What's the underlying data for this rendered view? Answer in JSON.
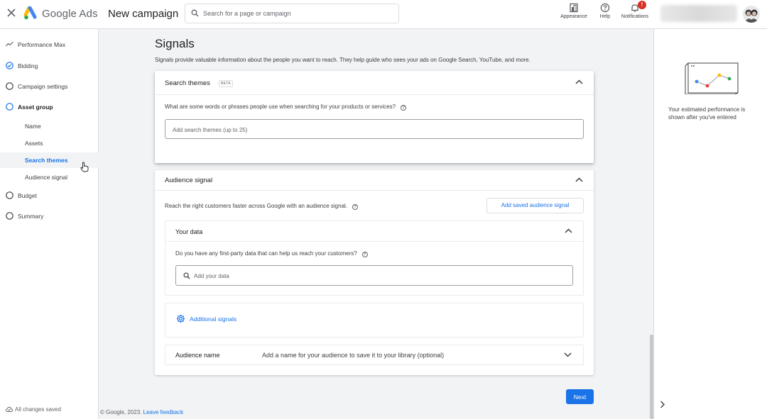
{
  "header": {
    "brand": "Google Ads",
    "campaign_title": "New campaign",
    "search_placeholder": "Search for a page or campaign",
    "appearance_label": "Appearance",
    "help_label": "Help",
    "notifications_label": "Notifications",
    "notifications_badge": "!"
  },
  "sidebar": {
    "items": [
      {
        "label": "Performance Max",
        "icon": "trend-icon"
      },
      {
        "label": "Bidding",
        "icon": "check-circle-icon"
      },
      {
        "label": "Campaign settings",
        "icon": "circle-icon"
      },
      {
        "label": "Asset group",
        "icon": "circle-icon"
      },
      {
        "label": "Budget",
        "icon": "circle-icon"
      },
      {
        "label": "Summary",
        "icon": "circle-icon"
      }
    ],
    "sub_items": [
      {
        "label": "Name"
      },
      {
        "label": "Assets"
      },
      {
        "label": "Search themes",
        "active": true
      },
      {
        "label": "Audience signal"
      }
    ],
    "saved_status": "All changes saved"
  },
  "main": {
    "title": "Signals",
    "description": "Signals provide valuable information about the people you want to reach. They help guide who sees your ads on Google Search, YouTube, and more.",
    "search_themes": {
      "title": "Search themes",
      "badge": "BETA",
      "question": "What are some words or phrases people use when searching for your products or services?",
      "input_placeholder": "Add search themes (up to 25)"
    },
    "audience_signal": {
      "title": "Audience signal",
      "description": "Reach the right customers faster across Google with an audience signal.",
      "add_saved_button": "Add saved audience signal",
      "your_data": {
        "title": "Your data",
        "question": "Do you have any first-party data that can help us reach your customers?",
        "input_placeholder": "Add your data"
      },
      "additional_signals": "Additional signals",
      "audience_name": {
        "label": "Audience name",
        "placeholder": "Add a name for your audience to save it to your library (optional)"
      }
    },
    "next_button": "Next"
  },
  "footer": {
    "copyright": "© Google, 2023.",
    "feedback_link": "Leave feedback"
  },
  "right_panel": {
    "performance_text": "Your estimated performance is shown after you've entered"
  },
  "colors": {
    "accent": "#1a73e8",
    "badge": "#d93025"
  }
}
